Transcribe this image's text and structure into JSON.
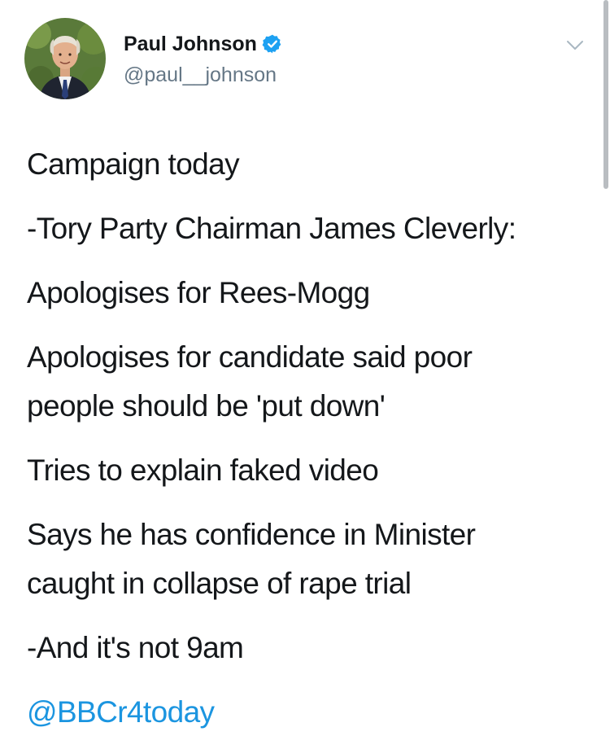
{
  "user": {
    "display_name": "Paul Johnson",
    "handle": "@paul__johnson",
    "verified": true
  },
  "tweet": {
    "paragraphs": [
      [
        "Campaign today"
      ],
      [
        "-Tory Party Chairman James Cleverly:"
      ],
      [
        "Apologises for Rees-Mogg"
      ],
      [
        "Apologises for candidate said poor",
        "people should be 'put down'"
      ],
      [
        "Tries to explain faked video"
      ],
      [
        "Says he has confidence in Minister",
        "caught in collapse of rape trial"
      ],
      [
        "-And it's not 9am"
      ]
    ],
    "mention": "@BBCr4today"
  },
  "icons": {
    "verified": "verified-badge-icon",
    "menu": "chevron-down-icon"
  },
  "colors": {
    "text": "#14171a",
    "handle": "#657786",
    "link": "#1b95e0",
    "verified": "#1da1f2"
  }
}
